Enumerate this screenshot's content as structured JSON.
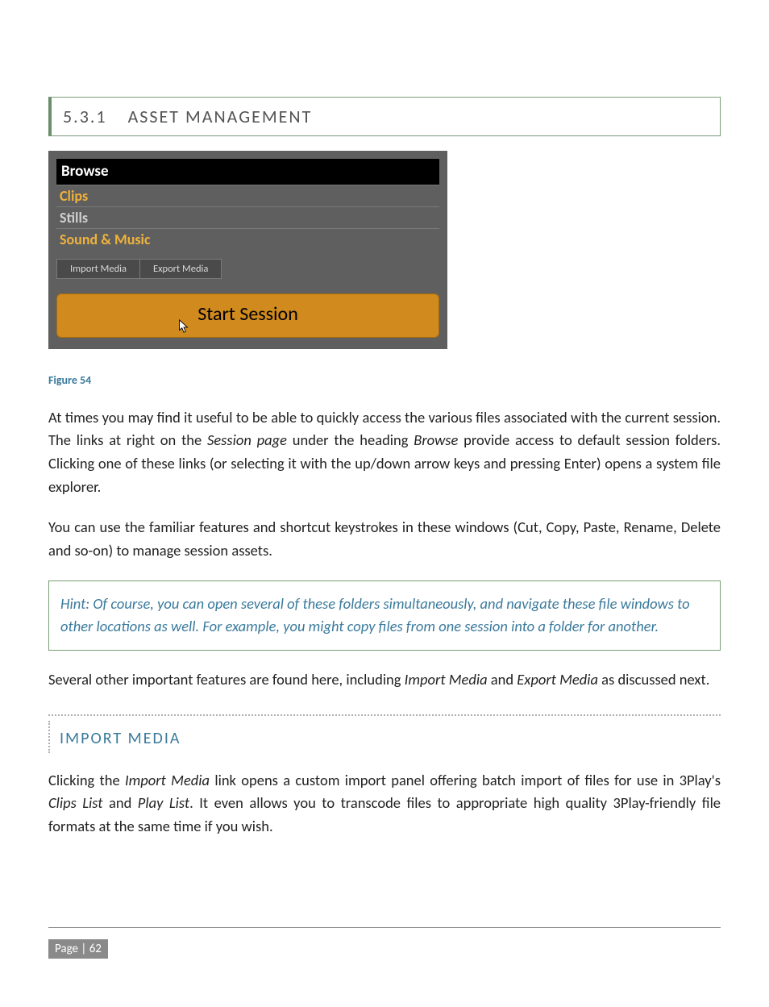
{
  "section": {
    "number": "5.3.1",
    "title": "ASSET MANAGEMENT"
  },
  "panel": {
    "browse": "Browse",
    "clips": "Clips",
    "stills": "Stills",
    "sound": "Sound & Music",
    "import_btn": "Import Media",
    "export_btn": "Export Media",
    "start": "Start Session"
  },
  "figure_label": "Figure 54",
  "para1": {
    "t1": "At times you may find it useful to be able to quickly access the various files associated with the current session.  The links at right on the ",
    "i1": "Session page",
    "t2": " under the heading ",
    "i2": "Browse",
    "t3": " provide access to default session folders.  Clicking one of these links (or selecting it with the up/down arrow keys and pressing Enter) opens a system file explorer."
  },
  "para2": "You can use the familiar features and shortcut keystrokes in these windows (Cut, Copy, Paste, Rename, Delete and so-on) to manage session assets.",
  "hint": "Hint: Of course, you can open several of these folders simultaneously, and navigate these file windows to other locations as well. For example, you might copy files from one session into a folder for another.",
  "para3": {
    "t1": "Several other important features are found here, including ",
    "i1": "Import Media",
    "t2": " and ",
    "i2": "Export Media",
    "t3": " as discussed next."
  },
  "subheading": "IMPORT MEDIA",
  "para4": {
    "t1": "Clicking the ",
    "i1": "Import Media",
    "t2": " link opens a custom import panel offering batch import of files for use in 3Play's ",
    "i2": "Clips List",
    "t3": " and ",
    "i3": "Play List",
    "t4": ". It even allows you to transcode files to appropriate high quality 3Play-friendly file formats at the same time if you wish."
  },
  "footer": {
    "page_label": "Page | 62"
  }
}
